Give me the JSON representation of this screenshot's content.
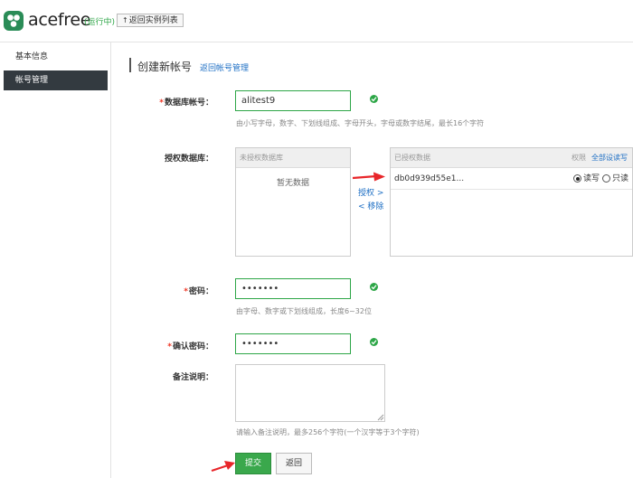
{
  "header": {
    "brand": "acefree",
    "status": "(运行中)",
    "back_arrow": "↑",
    "back_label": "返回实例列表"
  },
  "sidebar": {
    "items": [
      {
        "label": "基本信息",
        "active": false
      },
      {
        "label": "帐号管理",
        "active": true
      }
    ]
  },
  "page": {
    "title": "创建新帐号",
    "back_link": "返回帐号管理"
  },
  "form": {
    "account": {
      "required_mark": "*",
      "label": "数据库帐号：",
      "value": "alitest9",
      "hint": "由小写字母，数字、下划线组成、字母开头，字母或数字结尾，最长16个字符"
    },
    "databases": {
      "label": "授权数据库：",
      "left_header": "未授权数据库",
      "left_empty": "暂无数据",
      "grant_label": "授权 >",
      "remove_label": "< 移除",
      "right_header": "已授权数据",
      "perm_header": "权限",
      "set_all_label": "全部设读写",
      "rows": [
        {
          "name": "db0d939d55e1...",
          "rw_label": "读写",
          "ro_label": "只读",
          "selected": "rw"
        }
      ]
    },
    "password": {
      "required_mark": "*",
      "label": "密码：",
      "value": "•••••••",
      "hint": "由字母、数字或下划线组成，长度6~32位"
    },
    "confirm_password": {
      "required_mark": "*",
      "label": "确认密码：",
      "value": "•••••••"
    },
    "remark": {
      "label": "备注说明：",
      "hint": "请输入备注说明，最多256个字符(一个汉字等于3个字符)"
    }
  },
  "actions": {
    "submit_label": "提交",
    "back_label": "返回"
  },
  "colors": {
    "accent_green": "#2da647",
    "link_blue": "#1e6fc4",
    "annotation_red": "#e8262a",
    "sidebar_active": "#333a40"
  }
}
